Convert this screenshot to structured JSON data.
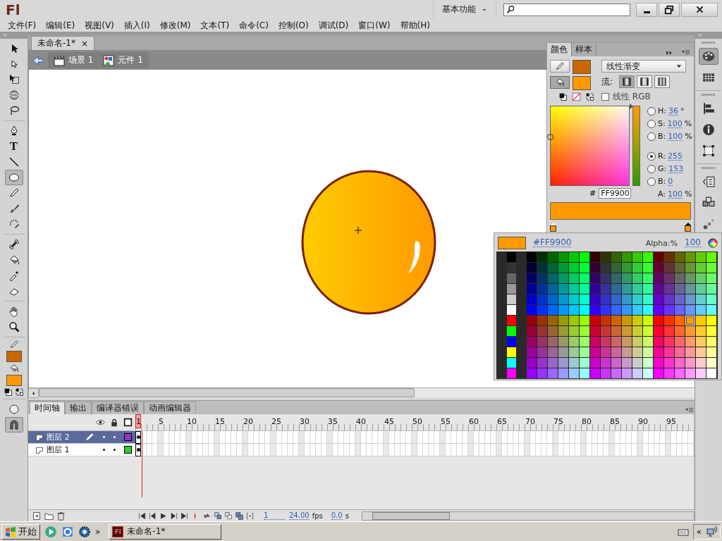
{
  "title_bar": {
    "logo": "Fl",
    "workspace": "基本功能"
  },
  "menus": [
    "文件(F)",
    "编辑(E)",
    "视图(V)",
    "插入(I)",
    "修改(M)",
    "文本(T)",
    "命令(C)",
    "控制(O)",
    "调试(D)",
    "窗口(W)",
    "帮助(H)"
  ],
  "tool_groups": [
    {
      "tools": [
        {
          "kind": "selection",
          "selected": false
        },
        {
          "kind": "subselection",
          "selected": false
        },
        {
          "kind": "free-transform",
          "selected": false
        },
        {
          "kind": "rotate-3d",
          "selected": false
        },
        {
          "kind": "lasso",
          "selected": false
        }
      ]
    },
    {
      "tools": [
        {
          "kind": "pen",
          "selected": false
        },
        {
          "kind": "text",
          "glyph": "T",
          "selected": false
        },
        {
          "kind": "line",
          "selected": false
        },
        {
          "kind": "oval",
          "selected": true
        },
        {
          "kind": "pencil",
          "selected": false
        },
        {
          "kind": "brush",
          "selected": false
        },
        {
          "kind": "deco",
          "selected": false
        }
      ]
    },
    {
      "tools": [
        {
          "kind": "bone",
          "selected": false
        },
        {
          "kind": "bucket",
          "selected": false
        },
        {
          "kind": "eyedropper",
          "selected": false
        },
        {
          "kind": "eraser",
          "selected": false
        }
      ]
    },
    {
      "tools": [
        {
          "kind": "hand",
          "selected": false
        },
        {
          "kind": "zoom",
          "selected": false
        }
      ]
    }
  ],
  "tool_colors": [
    {
      "kind": "stroke",
      "color": "#cc6600"
    },
    {
      "kind": "fill",
      "color": "#ff9900"
    }
  ],
  "document": {
    "tab": {
      "title": "未命名-1*",
      "close": "×"
    },
    "breadcrumbs": [
      {
        "kind": "scene",
        "label": "场景 1"
      },
      {
        "kind": "symbol",
        "label": "元件 1"
      }
    ]
  },
  "color_panel": {
    "tabs": [
      {
        "label": "颜色",
        "selected": true
      },
      {
        "label": "样本",
        "selected": false
      }
    ],
    "targets": [
      {
        "kind": "stroke",
        "color": "#cc6600",
        "selected": false
      },
      {
        "kind": "fill",
        "color": "#ff9900",
        "selected": true
      }
    ],
    "type": "线性渐变",
    "flow_label": "流:",
    "flow_modes": [
      {
        "kind": "extend",
        "selected": true
      },
      {
        "kind": "reflect",
        "selected": false
      },
      {
        "kind": "repeat",
        "selected": false
      }
    ],
    "linear_rgb": {
      "label": "线性 RGB",
      "checked": false
    },
    "channels": [
      {
        "kind": "radio",
        "label": "H:",
        "value": "36",
        "unit": "°",
        "selected": false
      },
      {
        "kind": "radio",
        "label": "S:",
        "value": "100",
        "unit": "%",
        "selected": false
      },
      {
        "kind": "radio",
        "label": "B:",
        "value": "100",
        "unit": "%",
        "selected": false
      },
      {
        "kind": "radio",
        "label": "R:",
        "value": "255",
        "selected": true
      },
      {
        "kind": "radio",
        "label": "G:",
        "value": "153",
        "selected": false
      },
      {
        "kind": "radio",
        "label": "B:",
        "value": "0",
        "selected": false
      },
      {
        "kind": "plain",
        "label": "A:",
        "value": "100",
        "unit": "%"
      }
    ],
    "hue_slider": {
      "level": 1
    },
    "hex_label": "#",
    "hex": "FF9900",
    "gradient_stops": [
      {
        "color": "#ff9900",
        "selected": false
      },
      {
        "color": "#ff9900",
        "selected": true
      }
    ]
  },
  "swatch_popup": {
    "color": "#ff9900",
    "hex": "#FF9900",
    "alpha_label": "Alpha:%",
    "alpha": "100",
    "rows": [
      {
        "cells": [
          {
            "color": "#000000",
            "selected": false
          },
          {
            "color": "#000000",
            "selected": false
          },
          {
            "color": "#003300",
            "selected": false
          },
          {
            "color": "#006600",
            "selected": false
          },
          {
            "color": "#009900",
            "selected": false
          },
          {
            "color": "#00cc00",
            "selected": false
          },
          {
            "color": "#00ff00",
            "selected": false
          },
          {
            "color": "#330000",
            "selected": false
          },
          {
            "color": "#333300",
            "selected": false
          },
          {
            "color": "#336600",
            "selected": false
          },
          {
            "color": "#339900",
            "selected": false
          },
          {
            "color": "#33cc00",
            "selected": false
          },
          {
            "color": "#33ff00",
            "selected": false
          },
          {
            "color": "#660000",
            "selected": false
          },
          {
            "color": "#663300",
            "selected": false
          },
          {
            "color": "#666600",
            "selected": false
          },
          {
            "color": "#669900",
            "selected": false
          },
          {
            "color": "#66cc00",
            "selected": false
          },
          {
            "color": "#66ff00",
            "selected": false
          }
        ]
      },
      {
        "cells": [
          {
            "color": "#333333",
            "selected": false
          },
          {
            "color": "#000033",
            "selected": false
          },
          {
            "color": "#003333",
            "selected": false
          },
          {
            "color": "#006633",
            "selected": false
          },
          {
            "color": "#009933",
            "selected": false
          },
          {
            "color": "#00cc33",
            "selected": false
          },
          {
            "color": "#00ff33",
            "selected": false
          },
          {
            "color": "#330033",
            "selected": false
          },
          {
            "color": "#333333",
            "selected": false
          },
          {
            "color": "#336633",
            "selected": false
          },
          {
            "color": "#339933",
            "selected": false
          },
          {
            "color": "#33cc33",
            "selected": false
          },
          {
            "color": "#33ff33",
            "selected": false
          },
          {
            "color": "#660033",
            "selected": false
          },
          {
            "color": "#663333",
            "selected": false
          },
          {
            "color": "#666633",
            "selected": false
          },
          {
            "color": "#669933",
            "selected": false
          },
          {
            "color": "#66cc33",
            "selected": false
          },
          {
            "color": "#66ff33",
            "selected": false
          }
        ]
      },
      {
        "cells": [
          {
            "color": "#666666",
            "selected": false
          },
          {
            "color": "#000066",
            "selected": false
          },
          {
            "color": "#003366",
            "selected": false
          },
          {
            "color": "#006666",
            "selected": false
          },
          {
            "color": "#009966",
            "selected": false
          },
          {
            "color": "#00cc66",
            "selected": false
          },
          {
            "color": "#00ff66",
            "selected": false
          },
          {
            "color": "#330066",
            "selected": false
          },
          {
            "color": "#333366",
            "selected": false
          },
          {
            "color": "#336666",
            "selected": false
          },
          {
            "color": "#339966",
            "selected": false
          },
          {
            "color": "#33cc66",
            "selected": false
          },
          {
            "color": "#33ff66",
            "selected": false
          },
          {
            "color": "#660066",
            "selected": false
          },
          {
            "color": "#663366",
            "selected": false
          },
          {
            "color": "#666666",
            "selected": false
          },
          {
            "color": "#669966",
            "selected": false
          },
          {
            "color": "#66cc66",
            "selected": false
          },
          {
            "color": "#66ff66",
            "selected": false
          }
        ]
      },
      {
        "cells": [
          {
            "color": "#999999",
            "selected": false
          },
          {
            "color": "#000099",
            "selected": false
          },
          {
            "color": "#003399",
            "selected": false
          },
          {
            "color": "#006699",
            "selected": false
          },
          {
            "color": "#009999",
            "selected": false
          },
          {
            "color": "#00cc99",
            "selected": false
          },
          {
            "color": "#00ff99",
            "selected": false
          },
          {
            "color": "#330099",
            "selected": false
          },
          {
            "color": "#333399",
            "selected": false
          },
          {
            "color": "#336699",
            "selected": false
          },
          {
            "color": "#339999",
            "selected": false
          },
          {
            "color": "#33cc99",
            "selected": false
          },
          {
            "color": "#33ff99",
            "selected": false
          },
          {
            "color": "#660099",
            "selected": false
          },
          {
            "color": "#663399",
            "selected": false
          },
          {
            "color": "#666699",
            "selected": false
          },
          {
            "color": "#669999",
            "selected": false
          },
          {
            "color": "#66cc99",
            "selected": false
          },
          {
            "color": "#66ff99",
            "selected": false
          }
        ]
      },
      {
        "cells": [
          {
            "color": "#cccccc",
            "selected": false
          },
          {
            "color": "#0000cc",
            "selected": false
          },
          {
            "color": "#0033cc",
            "selected": false
          },
          {
            "color": "#0066cc",
            "selected": false
          },
          {
            "color": "#0099cc",
            "selected": false
          },
          {
            "color": "#00cccc",
            "selected": false
          },
          {
            "color": "#00ffcc",
            "selected": false
          },
          {
            "color": "#3300cc",
            "selected": false
          },
          {
            "color": "#3333cc",
            "selected": false
          },
          {
            "color": "#3366cc",
            "selected": false
          },
          {
            "color": "#3399cc",
            "selected": false
          },
          {
            "color": "#33cccc",
            "selected": false
          },
          {
            "color": "#33ffcc",
            "selected": false
          },
          {
            "color": "#6600cc",
            "selected": false
          },
          {
            "color": "#6633cc",
            "selected": false
          },
          {
            "color": "#6666cc",
            "selected": false
          },
          {
            "color": "#6699cc",
            "selected": false
          },
          {
            "color": "#66cccc",
            "selected": false
          },
          {
            "color": "#66ffcc",
            "selected": false
          }
        ]
      },
      {
        "cells": [
          {
            "color": "#ffffff",
            "selected": false
          },
          {
            "color": "#0000ff",
            "selected": false
          },
          {
            "color": "#0033ff",
            "selected": false
          },
          {
            "color": "#0066ff",
            "selected": false
          },
          {
            "color": "#0099ff",
            "selected": false
          },
          {
            "color": "#00ccff",
            "selected": false
          },
          {
            "color": "#00ffff",
            "selected": false
          },
          {
            "color": "#3300ff",
            "selected": false
          },
          {
            "color": "#3333ff",
            "selected": false
          },
          {
            "color": "#3366ff",
            "selected": false
          },
          {
            "color": "#3399ff",
            "selected": false
          },
          {
            "color": "#33ccff",
            "selected": false
          },
          {
            "color": "#33ffff",
            "selected": false
          },
          {
            "color": "#6600ff",
            "selected": false
          },
          {
            "color": "#6633ff",
            "selected": false
          },
          {
            "color": "#6666ff",
            "selected": false
          },
          {
            "color": "#6699ff",
            "selected": false
          },
          {
            "color": "#66ccff",
            "selected": false
          },
          {
            "color": "#66ffff",
            "selected": false
          }
        ]
      },
      {
        "cells": [
          {
            "color": "#ff0000",
            "selected": false
          },
          {
            "color": "#990000",
            "selected": false
          },
          {
            "color": "#993300",
            "selected": false
          },
          {
            "color": "#996600",
            "selected": false
          },
          {
            "color": "#999900",
            "selected": false
          },
          {
            "color": "#99cc00",
            "selected": false
          },
          {
            "color": "#99ff00",
            "selected": false
          },
          {
            "color": "#cc0000",
            "selected": false
          },
          {
            "color": "#cc3300",
            "selected": false
          },
          {
            "color": "#cc6600",
            "selected": false
          },
          {
            "color": "#cc9900",
            "selected": false
          },
          {
            "color": "#cccc00",
            "selected": false
          },
          {
            "color": "#ccff00",
            "selected": false
          },
          {
            "color": "#ff0000",
            "selected": false
          },
          {
            "color": "#ff3300",
            "selected": false
          },
          {
            "color": "#ff6600",
            "selected": false
          },
          {
            "color": "#ff9900",
            "selected": true
          },
          {
            "color": "#ffcc00",
            "selected": false
          },
          {
            "color": "#ffff00",
            "selected": false
          }
        ]
      },
      {
        "cells": [
          {
            "color": "#00ff00",
            "selected": false
          },
          {
            "color": "#990033",
            "selected": false
          },
          {
            "color": "#993333",
            "selected": false
          },
          {
            "color": "#996633",
            "selected": false
          },
          {
            "color": "#999933",
            "selected": false
          },
          {
            "color": "#99cc33",
            "selected": false
          },
          {
            "color": "#99ff33",
            "selected": false
          },
          {
            "color": "#cc0033",
            "selected": false
          },
          {
            "color": "#cc3333",
            "selected": false
          },
          {
            "color": "#cc6633",
            "selected": false
          },
          {
            "color": "#cc9933",
            "selected": false
          },
          {
            "color": "#cccc33",
            "selected": false
          },
          {
            "color": "#ccff33",
            "selected": false
          },
          {
            "color": "#ff0033",
            "selected": false
          },
          {
            "color": "#ff3333",
            "selected": false
          },
          {
            "color": "#ff6633",
            "selected": false
          },
          {
            "color": "#ff9933",
            "selected": false
          },
          {
            "color": "#ffcc33",
            "selected": false
          },
          {
            "color": "#ffff33",
            "selected": false
          }
        ]
      },
      {
        "cells": [
          {
            "color": "#0000ff",
            "selected": false
          },
          {
            "color": "#990066",
            "selected": false
          },
          {
            "color": "#993366",
            "selected": false
          },
          {
            "color": "#996666",
            "selected": false
          },
          {
            "color": "#999966",
            "selected": false
          },
          {
            "color": "#99cc66",
            "selected": false
          },
          {
            "color": "#99ff66",
            "selected": false
          },
          {
            "color": "#cc0066",
            "selected": false
          },
          {
            "color": "#cc3366",
            "selected": false
          },
          {
            "color": "#cc6666",
            "selected": false
          },
          {
            "color": "#cc9966",
            "selected": false
          },
          {
            "color": "#cccc66",
            "selected": false
          },
          {
            "color": "#ccff66",
            "selected": false
          },
          {
            "color": "#ff0066",
            "selected": false
          },
          {
            "color": "#ff3366",
            "selected": false
          },
          {
            "color": "#ff6666",
            "selected": false
          },
          {
            "color": "#ff9966",
            "selected": false
          },
          {
            "color": "#ffcc66",
            "selected": false
          },
          {
            "color": "#ffff66",
            "selected": false
          }
        ]
      },
      {
        "cells": [
          {
            "color": "#ffff00",
            "selected": false
          },
          {
            "color": "#990099",
            "selected": false
          },
          {
            "color": "#993399",
            "selected": false
          },
          {
            "color": "#996699",
            "selected": false
          },
          {
            "color": "#999999",
            "selected": false
          },
          {
            "color": "#99cc99",
            "selected": false
          },
          {
            "color": "#99ff99",
            "selected": false
          },
          {
            "color": "#cc0099",
            "selected": false
          },
          {
            "color": "#cc3399",
            "selected": false
          },
          {
            "color": "#cc6699",
            "selected": false
          },
          {
            "color": "#cc9999",
            "selected": false
          },
          {
            "color": "#cccc99",
            "selected": false
          },
          {
            "color": "#ccff99",
            "selected": false
          },
          {
            "color": "#ff0099",
            "selected": false
          },
          {
            "color": "#ff3399",
            "selected": false
          },
          {
            "color": "#ff6699",
            "selected": false
          },
          {
            "color": "#ff9999",
            "selected": false
          },
          {
            "color": "#ffcc99",
            "selected": false
          },
          {
            "color": "#ffff99",
            "selected": false
          }
        ]
      },
      {
        "cells": [
          {
            "color": "#00ffff",
            "selected": false
          },
          {
            "color": "#9900cc",
            "selected": false
          },
          {
            "color": "#9933cc",
            "selected": false
          },
          {
            "color": "#9966cc",
            "selected": false
          },
          {
            "color": "#9999cc",
            "selected": false
          },
          {
            "color": "#99cccc",
            "selected": false
          },
          {
            "color": "#99ffcc",
            "selected": false
          },
          {
            "color": "#cc00cc",
            "selected": false
          },
          {
            "color": "#cc33cc",
            "selected": false
          },
          {
            "color": "#cc66cc",
            "selected": false
          },
          {
            "color": "#cc99cc",
            "selected": false
          },
          {
            "color": "#cccccc",
            "selected": false
          },
          {
            "color": "#ccffcc",
            "selected": false
          },
          {
            "color": "#ff00cc",
            "selected": false
          },
          {
            "color": "#ff33cc",
            "selected": false
          },
          {
            "color": "#ff66cc",
            "selected": false
          },
          {
            "color": "#ff99cc",
            "selected": false
          },
          {
            "color": "#ffcccc",
            "selected": false
          },
          {
            "color": "#ffffcc",
            "selected": false
          }
        ]
      },
      {
        "cells": [
          {
            "color": "#ff00ff",
            "selected": false
          },
          {
            "color": "#9900ff",
            "selected": false
          },
          {
            "color": "#9933ff",
            "selected": false
          },
          {
            "color": "#9966ff",
            "selected": false
          },
          {
            "color": "#9999ff",
            "selected": false
          },
          {
            "color": "#99ccff",
            "selected": false
          },
          {
            "color": "#99ffff",
            "selected": false
          },
          {
            "color": "#cc00ff",
            "selected": false
          },
          {
            "color": "#cc33ff",
            "selected": false
          },
          {
            "color": "#cc66ff",
            "selected": false
          },
          {
            "color": "#cc99ff",
            "selected": false
          },
          {
            "color": "#ccccff",
            "selected": false
          },
          {
            "color": "#ccffff",
            "selected": false
          },
          {
            "color": "#ff00ff",
            "selected": false
          },
          {
            "color": "#ff33ff",
            "selected": false
          },
          {
            "color": "#ff66ff",
            "selected": false
          },
          {
            "color": "#ff99ff",
            "selected": false
          },
          {
            "color": "#ffccff",
            "selected": false
          },
          {
            "color": "#ffffff",
            "selected": false
          }
        ]
      }
    ]
  },
  "panel_groups": [
    {
      "icons": [
        {
          "kind": "color",
          "selected": true
        },
        {
          "kind": "swatches",
          "selected": false
        }
      ]
    },
    {
      "icons": [
        {
          "kind": "align",
          "selected": false
        },
        {
          "kind": "info",
          "selected": false
        },
        {
          "kind": "transform",
          "selected": false
        }
      ]
    },
    {
      "icons": [
        {
          "kind": "actions",
          "selected": false
        },
        {
          "kind": "components",
          "selected": false
        },
        {
          "kind": "motion",
          "selected": false
        }
      ]
    }
  ],
  "timeline": {
    "tabs": [
      {
        "label": "时间轴",
        "selected": true
      },
      {
        "label": "输出",
        "selected": false
      },
      {
        "label": "编译器错误",
        "selected": false
      },
      {
        "label": "动画编辑器",
        "selected": false
      }
    ],
    "frames": [
      {
        "label": "1",
        "selected": true
      },
      {
        "label": "5",
        "selected": false
      },
      {
        "label": "10",
        "selected": false
      },
      {
        "label": "15",
        "selected": false
      },
      {
        "label": "20",
        "selected": false
      },
      {
        "label": "25",
        "selected": false
      },
      {
        "label": "30",
        "selected": false
      },
      {
        "label": "35",
        "selected": false
      },
      {
        "label": "40",
        "selected": false
      },
      {
        "label": "45",
        "selected": false
      },
      {
        "label": "50",
        "selected": false
      },
      {
        "label": "55",
        "selected": false
      },
      {
        "label": "60",
        "selected": false
      },
      {
        "label": "65",
        "selected": false
      },
      {
        "label": "70",
        "selected": false
      },
      {
        "label": "75",
        "selected": false
      },
      {
        "label": "80",
        "selected": false
      },
      {
        "label": "85",
        "selected": false
      },
      {
        "label": "90",
        "selected": false
      },
      {
        "label": "95",
        "selected": false
      }
    ],
    "layers": [
      {
        "name": "图层 2",
        "selected": true,
        "editing": true,
        "color": "#9933cc",
        "keyframe": true
      },
      {
        "name": "图层 1",
        "selected": false,
        "editing": false,
        "color": "#33cc33",
        "keyframe": true
      }
    ],
    "footer": {
      "current_frame": "1",
      "frame_rate": "24.00",
      "fps_unit": "fps",
      "elapsed": "0.0",
      "time_unit": "s"
    }
  },
  "taskbar": {
    "start": "开始",
    "more": "»",
    "tasks": [
      {
        "icon_label": "Fl",
        "title": "未命名-1*"
      }
    ],
    "tray_toggle": "«"
  }
}
